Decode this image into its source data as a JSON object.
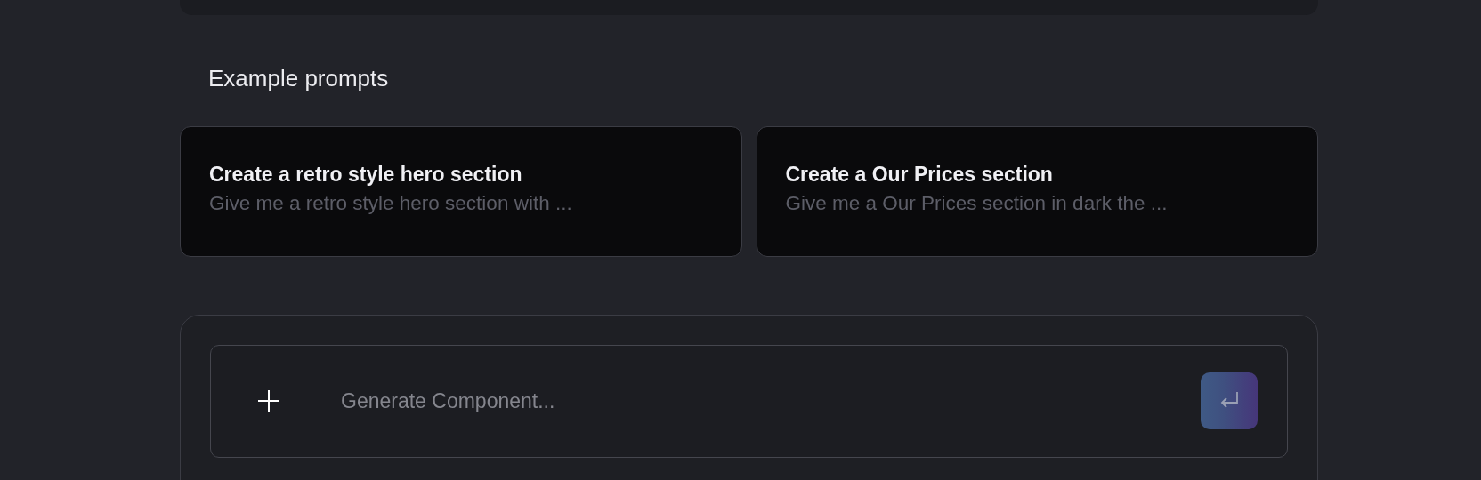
{
  "section_title": "Example prompts",
  "prompts": [
    {
      "title": "Create a retro style hero section",
      "description": "Give me a retro style hero section with ..."
    },
    {
      "title": "Create a Our Prices section",
      "description": "Give me a Our Prices section in dark the ..."
    }
  ],
  "composer": {
    "placeholder": "Generate Component..."
  }
}
